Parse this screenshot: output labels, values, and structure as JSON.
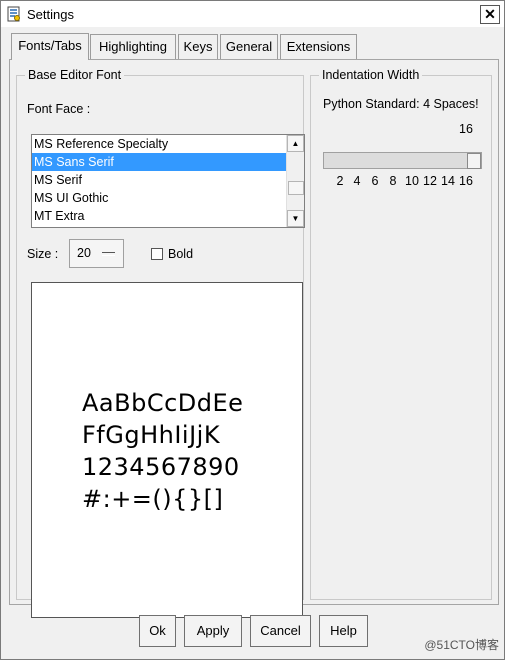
{
  "window": {
    "title": "Settings",
    "close_glyph": "✕",
    "icon": "settings-app-icon"
  },
  "tabs": [
    {
      "label": "Fonts/Tabs",
      "active": true
    },
    {
      "label": "Highlighting",
      "active": false
    },
    {
      "label": "Keys",
      "active": false
    },
    {
      "label": "General",
      "active": false
    },
    {
      "label": "Extensions",
      "active": false
    }
  ],
  "font_group": {
    "legend": "Base Editor Font",
    "font_face_label": "Font Face :",
    "fonts": [
      "MS Reference Specialty",
      "MS Sans Serif",
      "MS Serif",
      "MS UI Gothic",
      "MT Extra"
    ],
    "selected_font": "MS Sans Serif",
    "size_label": "Size :",
    "size_value": "20",
    "bold_label": "Bold",
    "bold_checked": false,
    "sample_lines": [
      "AaBbCcDdEe",
      "FfGgHhIiJjK",
      "1234567890",
      "#:+=(){}[]"
    ]
  },
  "indent_group": {
    "legend": "Indentation Width",
    "standard_text": "Python Standard: 4 Spaces!",
    "current_value": "16",
    "ticks": [
      "2",
      "4",
      "6",
      "8",
      "10",
      "12",
      "14",
      "16"
    ],
    "slider_fraction": 1.0
  },
  "buttons": {
    "ok": "Ok",
    "apply": "Apply",
    "cancel": "Cancel",
    "help": "Help"
  },
  "watermark": "@51CTO博客",
  "colors": {
    "selection": "#3399ff",
    "background": "#f0f0f0"
  }
}
